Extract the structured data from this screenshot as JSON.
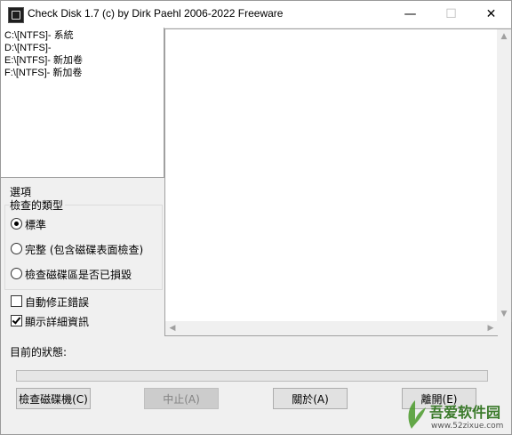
{
  "window": {
    "title": "Check Disk 1.7  (c) by Dirk Paehl  2006-2022 Freeware",
    "minimize": "—",
    "maximize": "☐",
    "close": "✕"
  },
  "drives": [
    {
      "label": "C:\\[NTFS]- 系統"
    },
    {
      "label": "D:\\[NTFS]-"
    },
    {
      "label": "E:\\[NTFS]- 新加卷"
    },
    {
      "label": "F:\\[NTFS]- 新加卷"
    }
  ],
  "options": {
    "section_label": "選項",
    "group_label": "檢查的類型",
    "radios": [
      {
        "label": "標準",
        "selected": true
      },
      {
        "label": "完整 (包含磁碟表面檢查)",
        "selected": false
      },
      {
        "label": "檢查磁碟區是否已損毀",
        "selected": false
      }
    ],
    "checkboxes": [
      {
        "label": "自動修正錯誤",
        "checked": false
      },
      {
        "label": "顯示詳細資訊",
        "checked": true
      }
    ]
  },
  "status": {
    "label": "目前的狀態:",
    "progress": 0
  },
  "buttons": {
    "check": "檢查磁碟機(C)",
    "stop": "中止(A)",
    "about": "關於(A)",
    "exit": "離開(E)"
  },
  "scroll_arrows": {
    "up": "▲",
    "down": "▼",
    "left": "◀",
    "right": "▶"
  },
  "watermark": {
    "text": "吾爱软件园",
    "url": "www.52zixue.com"
  }
}
